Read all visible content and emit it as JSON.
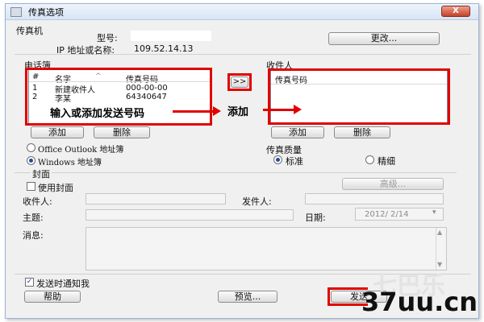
{
  "window": {
    "title": "传真选项",
    "close_label": "X"
  },
  "fax": {
    "group_title": "传真机",
    "model_label": "型号:",
    "model_value": "",
    "ip_label": "IP 地址或名称:",
    "ip_value": "109.52.14.13",
    "change_button": "更改..."
  },
  "phonebook": {
    "group_title": "电话簿",
    "columns": [
      "#",
      "名字",
      "传真号码"
    ],
    "rows": [
      {
        "index": "1",
        "name": "新建收件人",
        "number": "000-00-00"
      },
      {
        "index": "2",
        "name": "李某",
        "number": "64340647"
      }
    ],
    "add_button": "添加",
    "delete_button": "删除",
    "annotation": "输入或添加发送号码",
    "transfer_button": ">>",
    "source_outlook": "Office Outlook 地址簿",
    "source_windows": "Windows 地址簿"
  },
  "recipients": {
    "group_title": "收件人",
    "column": "传真号码",
    "add_button": "添加",
    "delete_button": "删除",
    "annotation": "添加"
  },
  "quality": {
    "group_title": "传真质量",
    "standard": "标准",
    "fine": "精细"
  },
  "cover": {
    "group_title": "封面",
    "use_cover": "使用封面",
    "advanced_button": "高级...",
    "recipient_label": "收件人:",
    "sender_label": "发件人:",
    "subject_label": "主题:",
    "date_label": "日期:",
    "date_value": "2012/ 2/14",
    "message_label": "消息:"
  },
  "footer": {
    "notify_label": "发送时通知我",
    "help_button": "帮助",
    "preview_button": "预览...",
    "send_button": "发送"
  },
  "watermark": {
    "text": "37uu.cn",
    "faint_text": "七巴乐"
  },
  "colors": {
    "annotation_red": "#e00000",
    "titlebar": "#d7e5f5"
  }
}
